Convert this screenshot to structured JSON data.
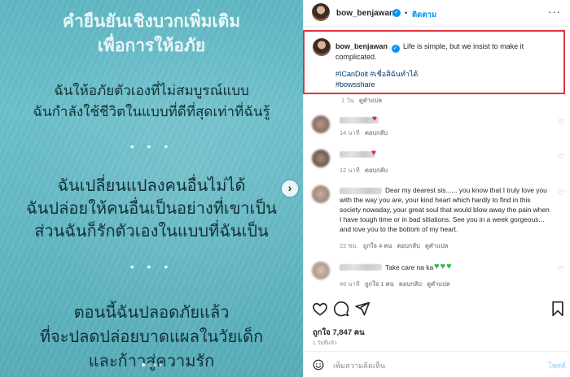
{
  "media": {
    "title_lines": [
      "คำยืนยันเชิงบวกเพิ่มเติม",
      "เพื่อการให้อภัย"
    ],
    "stanza1": [
      "ฉันให้อภัยตัวเองที่ไม่สมบูรณ์แบบ",
      "ฉันกำลังใช้ชีวิตในแบบที่ดีที่สุดเท่าที่ฉันรู้"
    ],
    "stanza2": [
      "ฉันเปลี่ยนแปลงคนอื่นไม่ได้",
      "ฉันปล่อยให้คนอื่นเป็นอย่างที่เขาเป็น",
      "ส่วนฉันก็รักตัวเองในแบบที่ฉันเป็น"
    ],
    "stanza3": [
      "ตอนนี้ฉันปลอดภัยแล้ว",
      "ที่จะปลดปล่อยบาดแผลในวัยเด็ก",
      "และก้าวสู่ความรัก"
    ],
    "divider": "• • •",
    "next_icon": "chevron-right-icon",
    "next_symbol": "›"
  },
  "header": {
    "username": "bow_benjawan",
    "verified_symbol": "✓",
    "separator": "•",
    "follow_label": "ติดตาม",
    "more_symbol": "···"
  },
  "caption": {
    "username": "bow_benjawan",
    "text": "Life is simple, but we insist to make it complicated.",
    "hashtags_line1": "#ICanDoit #เชื่อสิฉันทำได้",
    "hashtags_line2": "#bowsshare",
    "time": "1 วัน",
    "translate": "ดูคำแปล"
  },
  "comments": [
    {
      "time": "14 นาที",
      "reply": "ตอบกลับ",
      "suffix": "♥"
    },
    {
      "time": "12 นาที",
      "reply": "ตอบกลับ",
      "suffix": "♥"
    },
    {
      "text": "Dear my dearest sis...... you know that I truly love you with the way you are, your kind heart which hardly to find in this society nowaday, your great soul that would blow away the pain when I have tough time or in bad sitiations. See you in a week gorgeous... and love you to the bottom of my heart.",
      "time": "22 ชม.",
      "likes": "ถูกใจ 4 คน",
      "reply": "ตอบกลับ",
      "translate": "ดูคำแปล"
    },
    {
      "text": "Take care na ka",
      "suffix": "♥♥♥",
      "time": "46 นาที",
      "likes": "ถูกใจ 1 คน",
      "reply": "ตอบกลับ",
      "translate": "ดูคำแปล"
    }
  ],
  "likes_label": "ถูกใจ 7,847 คน",
  "date_label": "1 วันที่แล้ว",
  "add_comment": {
    "placeholder": "เพิ่มความคิดเห็น",
    "post_label": "โพสต์"
  },
  "colors": {
    "accent": "#0095f6",
    "highlight_border": "#e0343e",
    "hashtag": "#00376b"
  }
}
